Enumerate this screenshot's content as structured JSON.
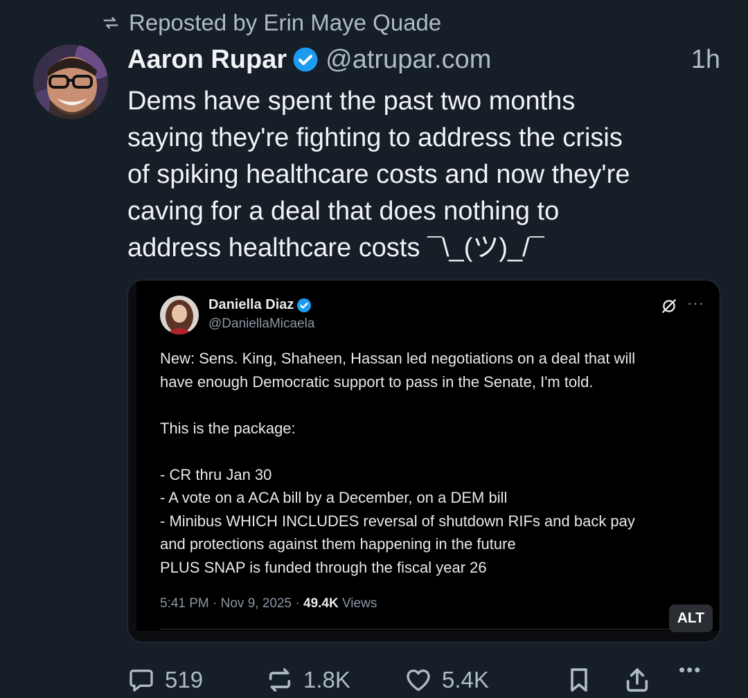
{
  "repost": {
    "label": "Reposted by Erin Maye Quade"
  },
  "post": {
    "author_name": "Aaron Rupar",
    "handle": "@atrupar.com",
    "time": "1h",
    "text": "Dems have spent the past two months\nsaying they're fighting to address the crisis\nof spiking healthcare costs and now they're\ncaving for a deal that does nothing to\naddress healthcare costs ¯\\_(ツ)_/¯"
  },
  "quoted": {
    "author_name": "Daniella Diaz",
    "handle": "@DaniellaMicaela",
    "text": "New: Sens. King, Shaheen, Hassan led negotiations on a deal that will\nhave enough Democratic support to pass in the Senate, I'm told.\n\nThis is the package:\n\n- CR thru Jan 30\n- A vote on a ACA bill by a December, on a DEM bill\n- Minibus WHICH INCLUDES reversal of shutdown RIFs and back pay\nand protections against them happening in the future\nPLUS SNAP is funded through the fiscal year 26",
    "timestamp": "5:41 PM · Nov 9, 2025 · ",
    "views_count": "49.4K",
    "views_label": " Views",
    "more": "···",
    "alt_label": "ALT"
  },
  "actions": {
    "replies": "519",
    "reposts": "1.8K",
    "likes": "5.4K",
    "more": "•••"
  },
  "colors": {
    "background": "#161e27",
    "text": "#f1f3f5",
    "muted": "#aebbc9",
    "verified": "#1d9bf0"
  },
  "icons": [
    "repost-icon",
    "verified-badge-icon",
    "grok-icon",
    "more-icon",
    "reply-icon",
    "like-icon",
    "bookmark-icon",
    "share-icon"
  ]
}
